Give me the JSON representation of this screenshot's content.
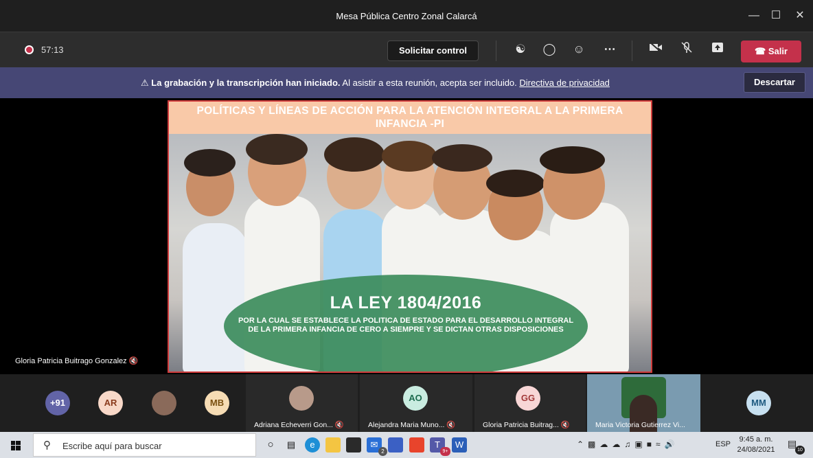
{
  "window": {
    "title": "Mesa Pública Centro Zonal Calarcá"
  },
  "controls": {
    "rec_time": "57:13",
    "request_control": "Solicitar control",
    "leave": "Salir"
  },
  "banner": {
    "bold": "La grabación y la transcripción han iniciado.",
    "text": "Al asistir a esta reunión, acepta ser incluido.",
    "link": "Directiva de privacidad",
    "dismiss": "Descartar"
  },
  "slide": {
    "header": "POLÍTICAS Y LÍNEAS DE ACCIÓN PARA LA ATENCIÓN INTEGRAL A LA PRIMERA INFANCIA -PI",
    "law_title": "LA LEY 1804/2016",
    "law_subtitle": "POR LA CUAL SE ESTABLECE LA POLITICA DE ESTADO PARA EL DESARROLLO INTEGRAL DE LA PRIMERA INFANCIA DE CERO A SIEMPRE Y SE DICTAN OTRAS DISPOSICIONES"
  },
  "speaker": {
    "name": "Gloria Patricia Buitrago Gonzalez"
  },
  "participants": {
    "overflow": "+91",
    "ar": "AR",
    "mb": "MB",
    "ao": "AO",
    "gg": "GG",
    "mm": "MM",
    "tile1_name": "Adriana Echeverri Gon...",
    "tile2_name": "Alejandra Maria Muno...",
    "tile3_name": "Gloria Patricia Buitrag...",
    "tile4_name": "Maria Victoria Gutierrez Vi..."
  },
  "taskbar": {
    "search_placeholder": "Escribe aquí para buscar",
    "lang": "ESP",
    "time": "9:45 a. m.",
    "date": "24/08/2021",
    "mail_badge": "2",
    "teams_badge": "9+",
    "notif_badge": "10"
  },
  "colors": {
    "accent": "#464775",
    "leave": "#c4314b",
    "slide_border": "#d23c3c",
    "oval": "#3d8d5e"
  }
}
